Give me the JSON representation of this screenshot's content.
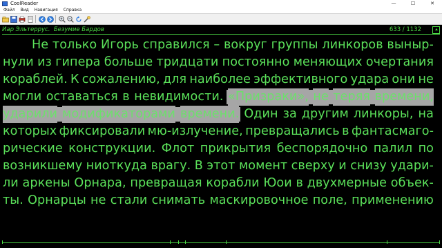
{
  "window": {
    "title": "CoolReader",
    "minimize": "—",
    "maximize": "☐",
    "close": "✕"
  },
  "menu": [
    "Файл",
    "Вид",
    "Навигация",
    "Справка"
  ],
  "header": {
    "author": "Иар Эльтеррус.",
    "book_title": "Безумие Бардов",
    "page_indicator": "633 / 1132"
  },
  "reader": {
    "lines": [
      [
        "Не",
        "только",
        "Игорь",
        "справился",
        "–",
        "вокруг",
        "группы",
        "линкоров",
        "выныр-"
      ],
      [
        "нули",
        "из",
        "гипера",
        "больше",
        "тридцати",
        "постоянно",
        "меняющих",
        "очертания"
      ],
      [
        "кораблей.",
        "К",
        "сожалению,",
        "для",
        "наиболее",
        "эффективного",
        "удара",
        "они",
        "не"
      ],
      [
        "могли",
        "оставаться",
        "в",
        "невидимости.",
        "«Призраки»,",
        "не",
        "теряя",
        "времени,"
      ],
      [
        "ударили",
        "модификаторами",
        "времени.",
        "Один",
        "за",
        "другим",
        "линкоры,",
        "на"
      ],
      [
        "которых",
        "фиксировали",
        "мю-излучение,",
        "превращались",
        "в",
        "фантасмаго-"
      ],
      [
        "рические",
        "конструкции.",
        "Флот",
        "прикрытия",
        "беспорядочно",
        "палил",
        "по"
      ],
      [
        "возникшему",
        "ниоткуда",
        "врагу.",
        "В",
        "этот",
        "момент",
        "сверху",
        "и",
        "снизу",
        "удари-"
      ],
      [
        "ли",
        "аркены",
        "Орнара,",
        "превращая",
        "корабли",
        "Юои",
        "в",
        "двухмерные",
        "объек-"
      ],
      [
        "ты.",
        "Орнарцы",
        "не",
        "стали",
        "снимать",
        "маскировочное",
        "поле,",
        "применению"
      ]
    ],
    "highlight": {
      "line4_words": "«Призраки», не теряя времени,",
      "line5_words": "ударили модификаторами времени."
    },
    "colors": {
      "text": "#5be15a",
      "background": "#000000",
      "highlight": "#a6a6a6"
    }
  },
  "toolbar": {
    "icons": [
      "open-icon",
      "save-icon",
      "print-icon",
      "bookmark-icon",
      "back-icon",
      "forward-icon",
      "zoom-in-icon",
      "zoom-out-icon",
      "rotate-icon",
      "settings-icon"
    ]
  }
}
